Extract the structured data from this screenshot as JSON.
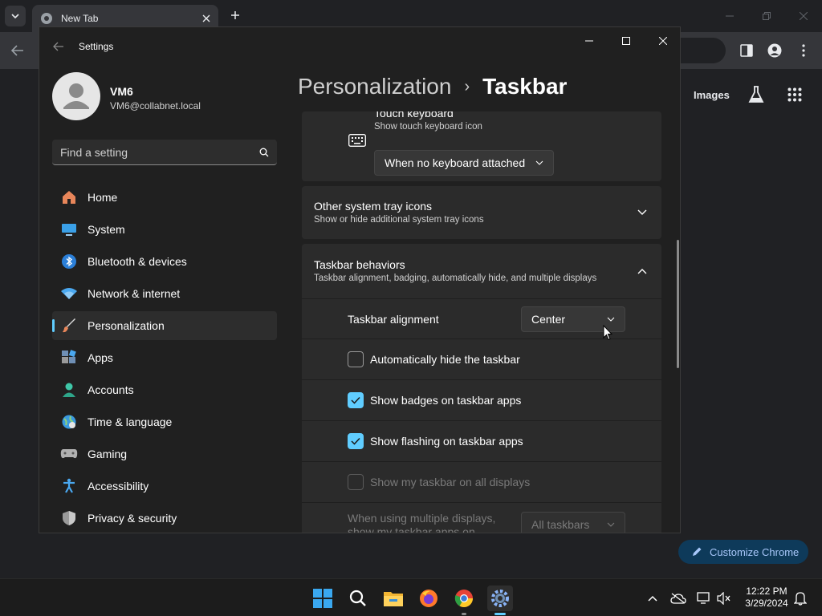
{
  "chrome": {
    "tab_title": "New Tab",
    "images_link": "Images",
    "customize_label": "Customize Chrome"
  },
  "settings": {
    "window_title": "Settings",
    "profile": {
      "name": "VM6",
      "email": "VM6@collabnet.local"
    },
    "search_placeholder": "Find a setting",
    "nav": [
      {
        "label": "Home",
        "icon": "home-icon"
      },
      {
        "label": "System",
        "icon": "monitor-icon"
      },
      {
        "label": "Bluetooth & devices",
        "icon": "bluetooth-icon"
      },
      {
        "label": "Network & internet",
        "icon": "wifi-icon"
      },
      {
        "label": "Personalization",
        "icon": "brush-icon",
        "active": true
      },
      {
        "label": "Apps",
        "icon": "apps-icon"
      },
      {
        "label": "Accounts",
        "icon": "person-icon"
      },
      {
        "label": "Time & language",
        "icon": "globe-clock-icon"
      },
      {
        "label": "Gaming",
        "icon": "gamepad-icon"
      },
      {
        "label": "Accessibility",
        "icon": "accessibility-icon"
      },
      {
        "label": "Privacy & security",
        "icon": "shield-icon"
      }
    ],
    "breadcrumb": {
      "parent": "Personalization",
      "current": "Taskbar"
    },
    "touch_keyboard": {
      "title": "Touch keyboard",
      "subtitle": "Show touch keyboard icon",
      "value": "When no keyboard attached"
    },
    "other_tray": {
      "title": "Other system tray icons",
      "subtitle": "Show or hide additional system tray icons"
    },
    "behaviors": {
      "title": "Taskbar behaviors",
      "subtitle": "Taskbar alignment, badging, automatically hide, and multiple displays",
      "alignment_label": "Taskbar alignment",
      "alignment_value": "Center",
      "options": [
        {
          "label": "Automatically hide the taskbar",
          "checked": false,
          "disabled": false
        },
        {
          "label": "Show badges on taskbar apps",
          "checked": true,
          "disabled": false
        },
        {
          "label": "Show flashing on taskbar apps",
          "checked": true,
          "disabled": false
        },
        {
          "label": "Show my taskbar on all displays",
          "checked": false,
          "disabled": true
        }
      ],
      "multi_display_label": "When using multiple displays, show my taskbar apps on",
      "multi_display_value": "All taskbars"
    }
  },
  "taskbar": {
    "time": "12:22 PM",
    "date": "3/29/2024"
  },
  "colors": {
    "accent": "#60cdff",
    "window_bg": "#202020",
    "card_bg": "#2b2b2b"
  }
}
